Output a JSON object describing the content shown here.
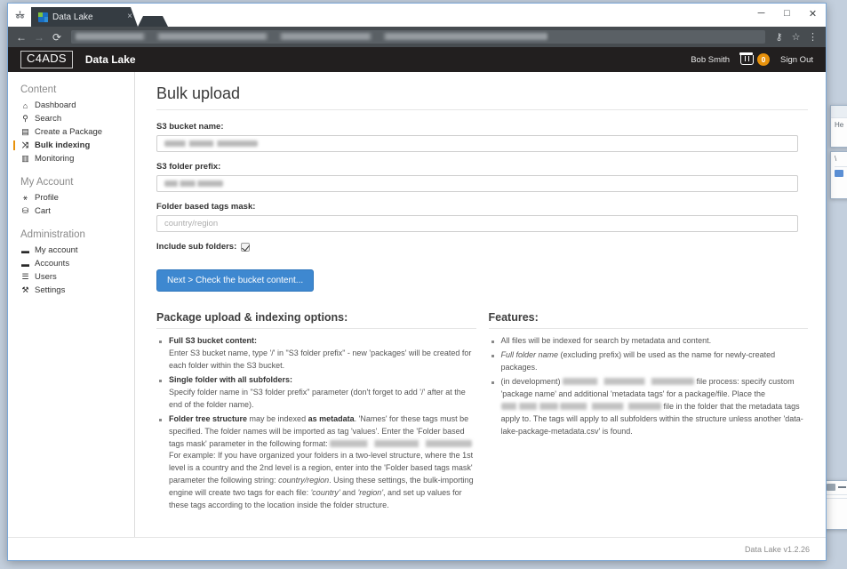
{
  "browser": {
    "tab": {
      "title": "Data Lake",
      "close_label": "×",
      "favicon": "datalake-favicon"
    },
    "window_controls": {
      "minimize": "─",
      "maximize": "□",
      "close": "✕"
    },
    "toolbar": {
      "back": "←",
      "forward": "→",
      "reload": "⟳",
      "url_value": "",
      "password_key_icon": "⚷",
      "bookmark_star": "☆",
      "menu_kebab": "⋮"
    }
  },
  "header": {
    "logo": "C4ADS",
    "app_name": "Data Lake",
    "user_name": "Bob Smith",
    "cart_count": "0",
    "sign_out": "Sign Out",
    "accent_orange": "#e8920c",
    "background": "#221f1f"
  },
  "sidebar": {
    "groups": [
      {
        "title": "Content",
        "items": [
          {
            "label": "Dashboard",
            "icon": "home-icon",
            "glyph": "⌂",
            "active": false
          },
          {
            "label": "Search",
            "icon": "search-icon",
            "glyph": "⚲",
            "active": false
          },
          {
            "label": "Create a Package",
            "icon": "package-icon",
            "glyph": "▤",
            "active": false
          },
          {
            "label": "Bulk indexing",
            "icon": "shuffle-icon",
            "glyph": "⤨",
            "active": true
          },
          {
            "label": "Monitoring",
            "icon": "monitor-icon",
            "glyph": "▥",
            "active": false
          }
        ]
      },
      {
        "title": "My Account",
        "items": [
          {
            "label": "Profile",
            "icon": "user-icon",
            "glyph": "⚹",
            "active": false
          },
          {
            "label": "Cart",
            "icon": "cart-icon",
            "glyph": "⛁",
            "active": false
          }
        ]
      },
      {
        "title": "Administration",
        "items": [
          {
            "label": "My account",
            "icon": "briefcase-icon",
            "glyph": "▬",
            "active": false
          },
          {
            "label": "Accounts",
            "icon": "briefcase-icon",
            "glyph": "▬",
            "active": false
          },
          {
            "label": "Users",
            "icon": "list-icon",
            "glyph": "☰",
            "active": false
          },
          {
            "label": "Settings",
            "icon": "wrench-icon",
            "glyph": "⚒",
            "active": false
          }
        ]
      }
    ]
  },
  "main": {
    "page_title": "Bulk upload",
    "fields": [
      {
        "label": "S3 bucket name:",
        "value": "redacted",
        "placeholder": ""
      },
      {
        "label": "S3 folder prefix:",
        "value": "redacted",
        "placeholder": ""
      },
      {
        "label": "Folder based tags mask:",
        "value": "",
        "placeholder": "country/region"
      }
    ],
    "checkbox": {
      "label": "Include sub folders:",
      "checked": true
    },
    "submit_button": "Next > Check the bucket content...",
    "help_left": {
      "title": "Package upload & indexing options:",
      "items": [
        {
          "bold_lead": "Full S3 bucket content:",
          "text": "Enter S3 bucket name, type '/' in \"S3 folder prefix\" - new 'packages' will be created for each folder within the S3 bucket."
        },
        {
          "bold_lead": "Single folder with all subfolders:",
          "text": "Specify folder name in \"S3 folder prefix\" parameter (don't forget to add '/' after at the end of the folder name)."
        },
        {
          "inline_lead_bold": "Folder tree structure",
          "inline_mid": " may be indexed ",
          "inline_bold2": "as metadata",
          "text_a": ". 'Names' for these tags must be specified. The folder names will be imported as tag 'values'. Enter the 'Folder based tags mask' parameter in the following format:",
          "redacted_a": true,
          "text_b": "For example: If you have organized your folders in a two-level structure, where the 1st level is a country and the 2nd level is a region, enter into the 'Folder based tags mask' parameter the following string: ",
          "italic_b": "country/region",
          "text_c": ". Using these settings, the bulk-importing engine will create two tags for each file: ",
          "italic_c1": "'country'",
          "text_d": " and ",
          "italic_c2": "'region'",
          "text_e": ", and set up values for these tags according to the location inside the folder structure."
        }
      ]
    },
    "help_right": {
      "title": "Features:",
      "items": [
        {
          "text": "All files will be indexed for search by metadata and content."
        },
        {
          "italic_lead": "Full folder name",
          "text": " (excluding prefix) will be used as the name for newly-created packages."
        },
        {
          "lead": "(in development)",
          "redacted_1": true,
          "text_a": "file process: specify custom 'package name' and additional 'metadata tags' for a package/file. Place the",
          "redacted_2": true,
          "text_b": "file in the folder that the metadata tags apply to. The tags will apply to all subfolders within the structure unless another 'data-lake-package-metadata.csv' is found."
        }
      ]
    }
  },
  "footer": {
    "version": "Data Lake v1.2.26"
  },
  "background_windows": {
    "win_a": {
      "close": "✕",
      "label": "He"
    },
    "win_b": {
      "mark": "\\"
    },
    "win_c": {
      "label": "a - -"
    }
  }
}
